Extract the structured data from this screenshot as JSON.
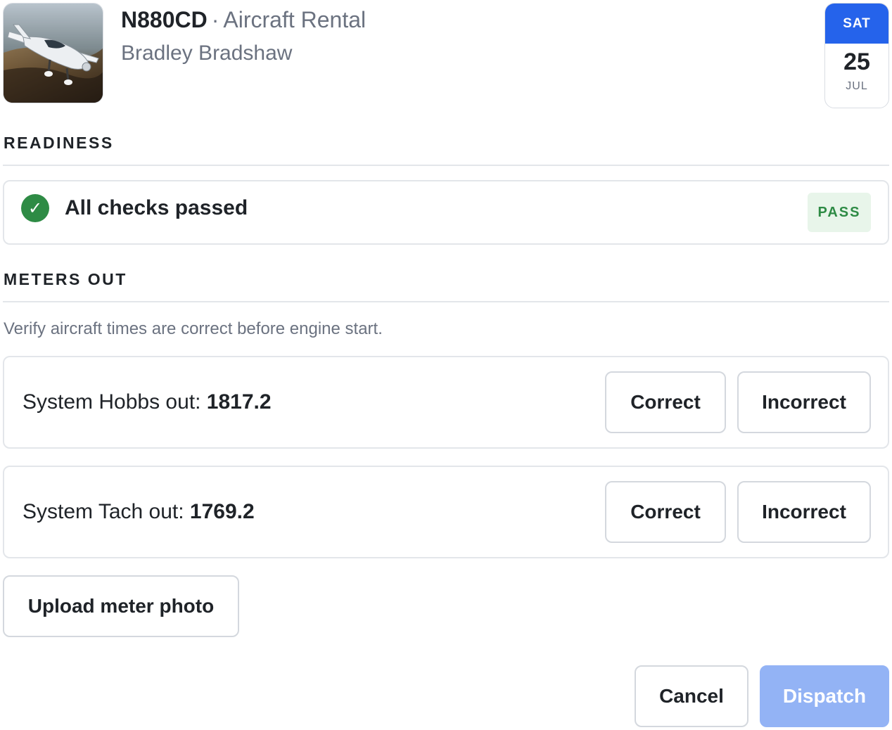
{
  "header": {
    "tail_number": "N880CD",
    "separator": "·",
    "kind": "Aircraft Rental",
    "customer": "Bradley Bradshaw",
    "thumbnail_icon": "aircraft-photo"
  },
  "date_card": {
    "day_of_week": "SAT",
    "day": "25",
    "month": "JUL",
    "accent_color": "#2563eb"
  },
  "readiness": {
    "title": "READINESS",
    "status_icon": "check-circle-icon",
    "status_text": "All checks passed",
    "badge": "PASS",
    "badge_color": "#2e8b45"
  },
  "meters": {
    "title": "METERS OUT",
    "hint": "Verify aircraft times are correct before engine start.",
    "items": [
      {
        "label": "System Hobbs out: ",
        "value": "1817.2",
        "correct_label": "Correct",
        "incorrect_label": "Incorrect"
      },
      {
        "label": "System Tach out: ",
        "value": "1769.2",
        "correct_label": "Correct",
        "incorrect_label": "Incorrect"
      }
    ],
    "upload_label": "Upload meter photo"
  },
  "footer": {
    "cancel_label": "Cancel",
    "dispatch_label": "Dispatch"
  }
}
